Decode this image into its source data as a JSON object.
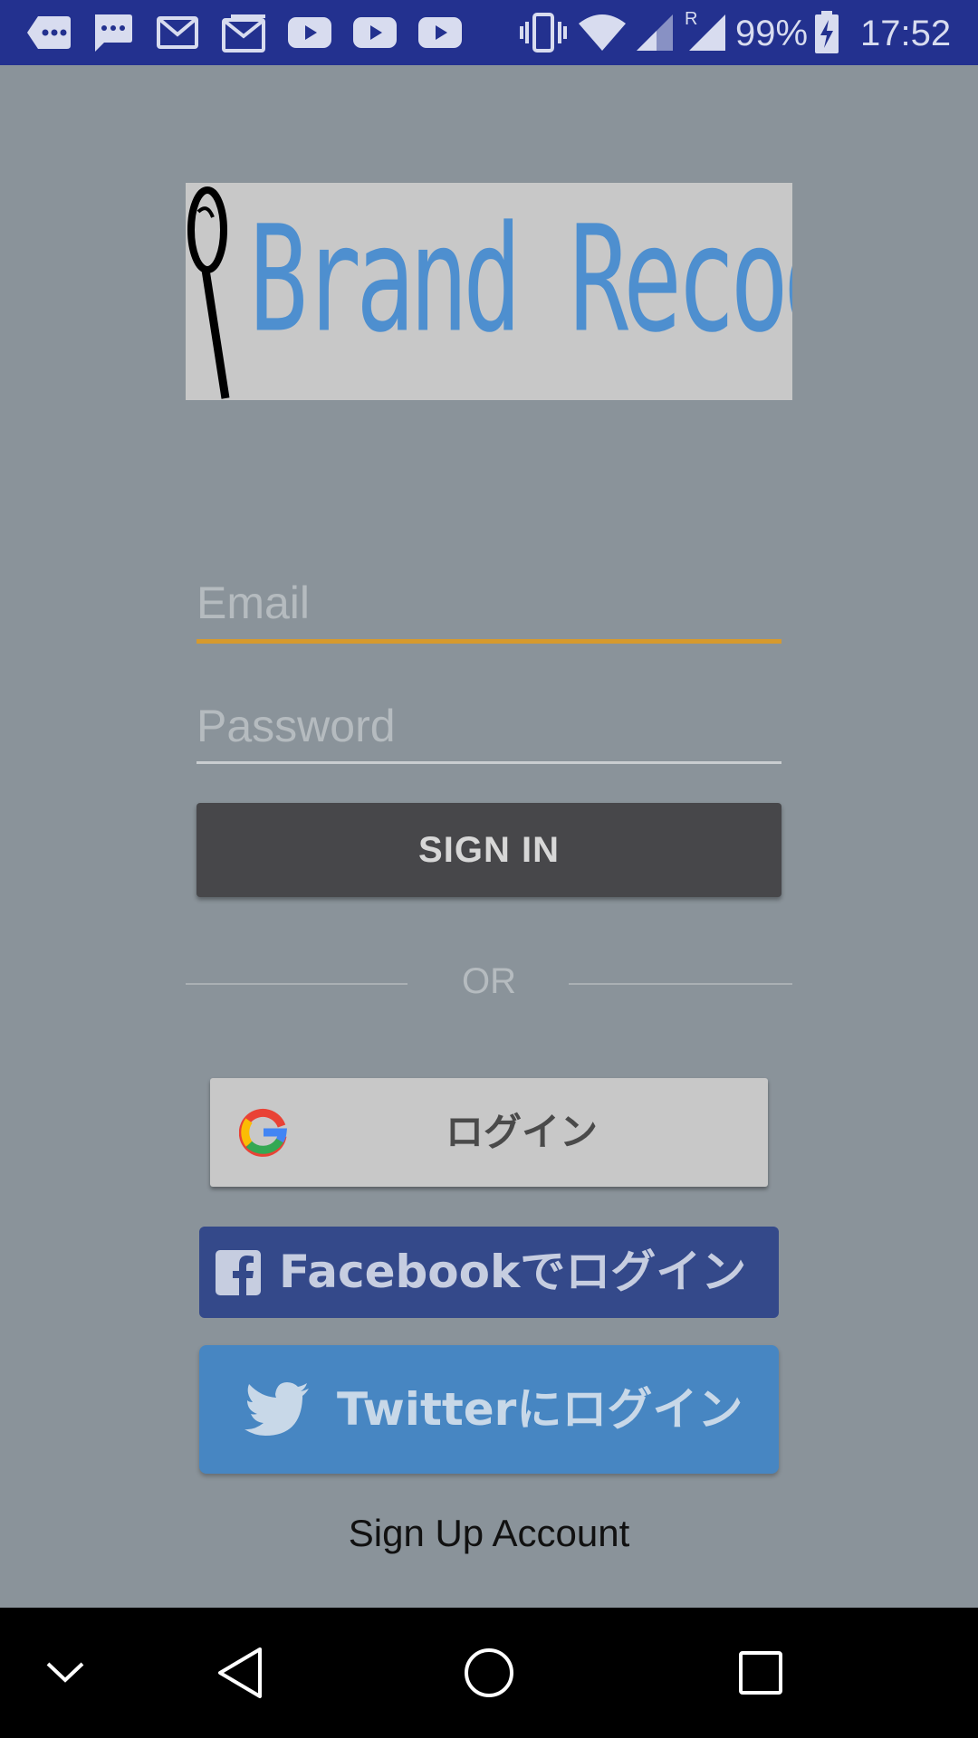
{
  "status_bar": {
    "battery": "99%",
    "time": "17:52",
    "roaming_label": "R",
    "notification_icons": [
      "chat-bubble-icon",
      "sms-icon",
      "gmail-icon",
      "gmail-icon",
      "youtube-icon",
      "youtube-icon",
      "youtube-icon"
    ],
    "system_icons": [
      "vibrate-icon",
      "wifi-icon",
      "signal-icon",
      "signal-roaming-icon",
      "battery-charging-icon"
    ]
  },
  "logo": {
    "text": "Brand Recognizer",
    "icon": "magnifier-icon"
  },
  "form": {
    "email_placeholder": "Email",
    "password_placeholder": "Password",
    "sign_in_label": "SIGN IN"
  },
  "divider": {
    "label": "OR"
  },
  "social": {
    "google_label": "ログイン",
    "facebook_label": "Facebookでログイン",
    "twitter_label": "Twitterにログイン"
  },
  "sign_up_label": "Sign Up Account",
  "nav_bar": {
    "icons": [
      "collapse-icon",
      "back-icon",
      "home-icon",
      "recents-icon"
    ]
  },
  "colors": {
    "background": "#8a939a",
    "status_bar": "#23318f",
    "accent_underline": "#d69a2e",
    "sign_in_button": "#47474a",
    "facebook": "#34498a",
    "twitter": "#4786c2",
    "logo_text": "#4e8fcf"
  }
}
